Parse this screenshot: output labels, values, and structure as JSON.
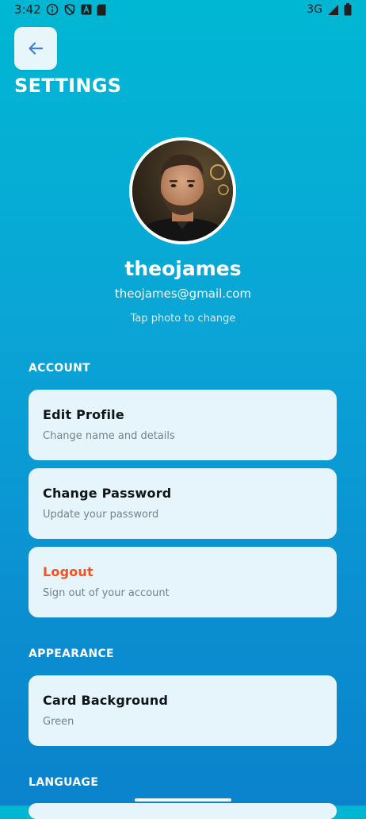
{
  "status_bar": {
    "time": "3:42",
    "network": "3G",
    "left_icons": [
      "info-icon",
      "shield-icon",
      "a-box-icon",
      "sd-card-icon"
    ],
    "right_icons": [
      "signal-icon",
      "battery-icon"
    ]
  },
  "header": {
    "back_icon": "arrow-left-icon",
    "title": "SETTINGS"
  },
  "profile": {
    "username": "theojames",
    "email": "theojames@gmail.com",
    "photo_hint": "Tap photo to change"
  },
  "sections": {
    "account": {
      "label": "ACCOUNT",
      "items": [
        {
          "title": "Edit Profile",
          "subtitle": "Change name and details"
        },
        {
          "title": "Change Password",
          "subtitle": "Update your password"
        },
        {
          "title": "Logout",
          "subtitle": "Sign out of your account",
          "color": "#f4511e"
        }
      ]
    },
    "appearance": {
      "label": "APPEARANCE",
      "items": [
        {
          "title": "Card Background",
          "subtitle": "Green"
        }
      ]
    },
    "language": {
      "label": "LANGUAGE"
    }
  },
  "colors": {
    "background_top": "#00b7d3",
    "background_bottom": "#0a83cc",
    "card": "#e6f4fb",
    "danger": "#f4511e",
    "back_arrow": "#3f7fd6"
  }
}
